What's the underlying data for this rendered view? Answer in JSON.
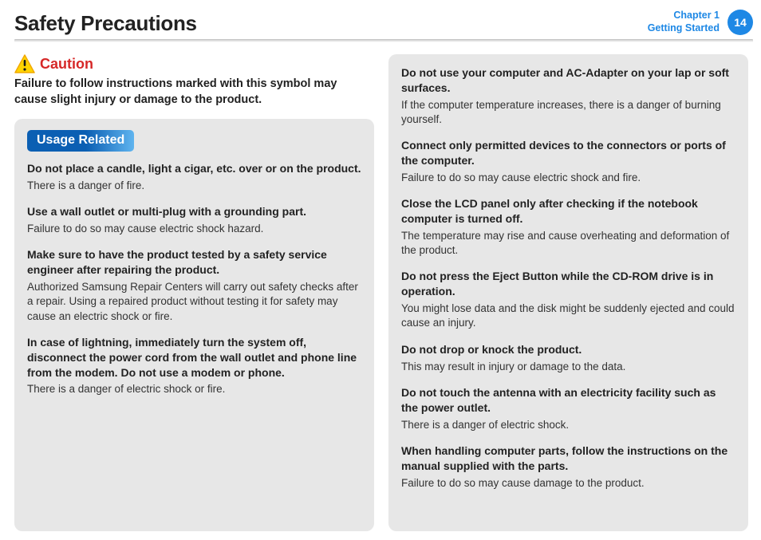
{
  "header": {
    "title": "Safety Precautions",
    "chapter_line1": "Chapter 1",
    "chapter_line2": "Getting Started",
    "page_number": "14"
  },
  "caution": {
    "label": "Caution",
    "description": "Failure to follow instructions marked with this symbol may cause slight injury or damage to the product."
  },
  "left_section": {
    "chip": "Usage Related",
    "items": [
      {
        "h": "Do not place a candle, light a cigar, etc. over or on the product.",
        "b": "There is a danger of fire."
      },
      {
        "h": "Use a wall outlet or multi-plug with a grounding part.",
        "b": "Failure to do so may cause electric shock hazard."
      },
      {
        "h": "Make sure to have the product tested by a safety service engineer after repairing the product.",
        "b": "Authorized Samsung Repair Centers will carry out safety checks after a repair. Using a repaired product without testing it for safety may cause an electric shock or fire."
      },
      {
        "h": "In case of lightning, immediately turn the system off, disconnect the power cord from the wall outlet and phone line from the modem. Do not use a modem or phone.",
        "b": "There is a danger of electric shock or fire."
      }
    ]
  },
  "right_section": {
    "items": [
      {
        "h": "Do not use your computer and AC-Adapter on your lap or soft surfaces.",
        "b": "If the computer temperature increases, there is a danger of burning yourself."
      },
      {
        "h": "Connect only permitted devices to the connectors or ports of the computer.",
        "b": "Failure to do so may cause electric shock and fire."
      },
      {
        "h": "Close the LCD panel only after checking if the notebook computer is turned off.",
        "b": "The temperature may rise and cause overheating and deformation of the product."
      },
      {
        "h": "Do not press the Eject Button while the CD-ROM drive is in operation.",
        "b": "You might lose data and the disk might be suddenly ejected and could cause an injury."
      },
      {
        "h": "Do not drop or knock the product.",
        "b": "This may result in injury or damage to the data."
      },
      {
        "h": "Do not touch the antenna with an electricity facility such as the power outlet.",
        "b": "There is a danger of electric shock."
      },
      {
        "h": "When handling computer parts, follow the instructions on the manual supplied with the parts.",
        "b": "Failure to do so may cause damage to the product."
      }
    ]
  }
}
